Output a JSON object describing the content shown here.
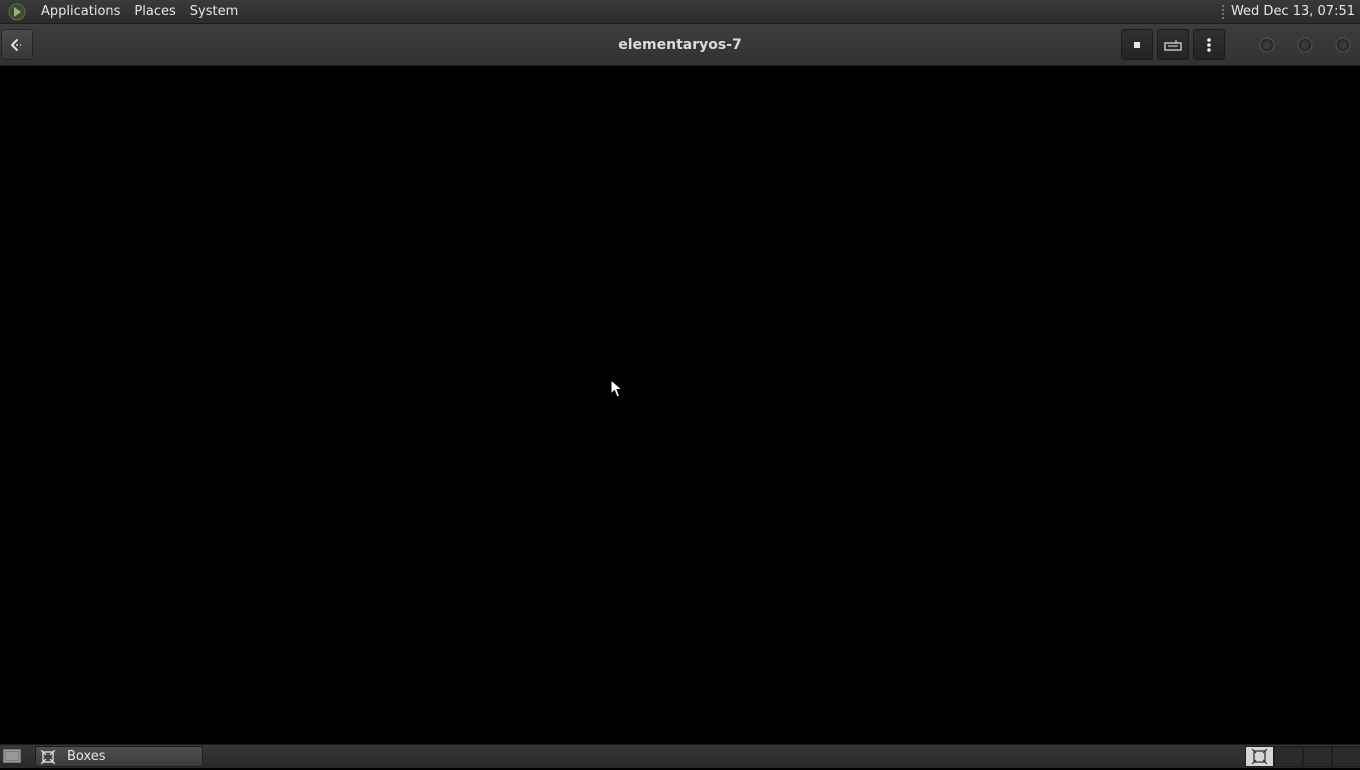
{
  "top_panel": {
    "menus": [
      "Applications",
      "Places",
      "System"
    ],
    "clock": "Wed Dec 13, 07:51",
    "logo_icon": "gnome-foot-logo-icon"
  },
  "headerbar": {
    "title": "elementaryos-7",
    "back_icon": "back-arrow-icon",
    "buttons": [
      {
        "name": "stop-button",
        "icon": "stop-square-icon"
      },
      {
        "name": "keyboard-button",
        "icon": "keyboard-icon"
      },
      {
        "name": "menu-button",
        "icon": "vertical-dots-icon"
      }
    ],
    "window_controls": [
      "minimize",
      "maximize",
      "close"
    ]
  },
  "taskbar": {
    "show_desktop_icon": "show-desktop-icon",
    "tasks": [
      {
        "label": "Boxes",
        "icon": "boxes-app-icon"
      }
    ],
    "workspaces": 2,
    "active_workspace": 1
  },
  "colors": {
    "panel": "#2c2c2c",
    "headerbar": "#383838",
    "content": "#000000",
    "text": "#e6e6e6"
  }
}
